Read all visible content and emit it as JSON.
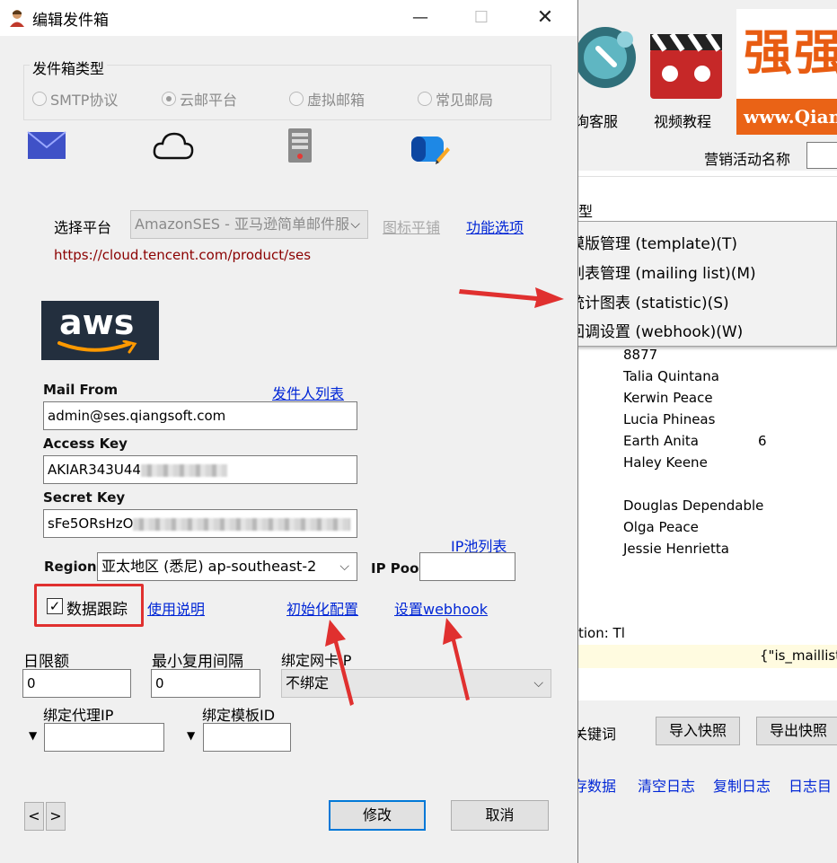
{
  "background_app": {
    "toolbar": {
      "service_label": "询客服",
      "video_label": "视频教程",
      "banner_logo": "强强",
      "banner_url": "www.Qiang"
    },
    "campaign_name_label": "营销活动名称",
    "type_label": "型",
    "list": [
      "8877",
      "Talia Quintana",
      "Kerwin Peace",
      "Lucia Phineas",
      "Earth Anita",
      "Haley Keene",
      "Douglas Dependable",
      "Olga Peace",
      "Jessie Henrietta"
    ],
    "list_extra_value": "6",
    "action_text": "tion: Tl",
    "json_snippet": "{\"is_maillist\"",
    "keyword_label": "关键词",
    "import_snapshot": "导入快照",
    "export_snapshot": "导出快照",
    "bottom_links": [
      "存数据",
      "清空日志",
      "复制日志",
      "日志目"
    ]
  },
  "context_menu": {
    "items": [
      "模版管理 (template)(T)",
      "列表管理 (mailing list)(M)",
      "统计图表 (statistic)(S)",
      "回调设置 (webhook)(W)"
    ]
  },
  "dialog": {
    "title": "编辑发件箱",
    "mailbox_type_group": "发件箱类型",
    "radios": [
      "SMTP协议",
      "云邮平台",
      "虚拟邮箱",
      "常见邮局"
    ],
    "selected_radio": "云邮平台",
    "platform_label": "选择平台",
    "platform_value": "AmazonSES - 亚马逊简单邮件服",
    "icon_tile_link": "图标平铺",
    "features_link": "功能选项",
    "platform_url": "https://cloud.tencent.com/product/ses",
    "aws_logo_text": "aws",
    "mail_from_label": "Mail From",
    "sender_list_link": "发件人列表",
    "mail_from_value": "admin@ses.qiangsoft.com",
    "access_key_label": "Access Key",
    "access_key_value": "AKIAR343U44",
    "secret_key_label": "Secret Key",
    "secret_key_value": "sFe5ORsHzO",
    "region_label": "Region",
    "region_value": "亚太地区 (悉尼) ap-southeast-2",
    "ip_pool_label": "IP Pool",
    "ip_pool_list_link": "IP池列表",
    "ip_pool_value": "",
    "tracking_label": "数据跟踪",
    "tracking_checked": true,
    "usage_link": "使用说明",
    "init_config_link": "初始化配置",
    "webhook_link": "设置webhook",
    "daily_limit_label": "日限额",
    "daily_limit_value": "0",
    "min_reuse_label": "最小复用间隔",
    "min_reuse_value": "0",
    "bind_nic_label": "绑定网卡IP",
    "bind_nic_value": "不绑定",
    "bind_proxy_label": "绑定代理IP",
    "bind_template_label": "绑定模板ID",
    "prev_label": "<",
    "next_label": ">",
    "modify_button": "修改",
    "cancel_button": "取消"
  },
  "colors": {
    "accent_red": "#e0302f",
    "link_blue": "#0026d6",
    "url_dark_red": "#8b0000",
    "aws_bg": "#232f3e",
    "aws_orange": "#ff9900"
  }
}
